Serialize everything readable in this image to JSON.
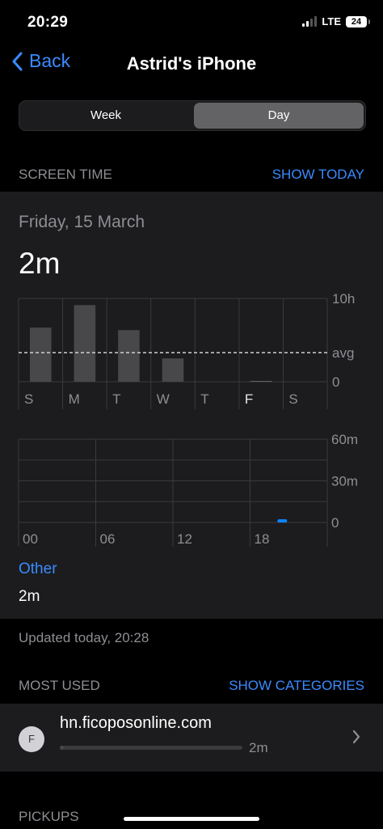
{
  "status_bar": {
    "time": "20:29",
    "network": "LTE",
    "battery": "24"
  },
  "nav": {
    "back_label": "Back",
    "title": "Astrid's iPhone"
  },
  "segments": {
    "week": "Week",
    "day": "Day",
    "selected": "Day"
  },
  "screen_time": {
    "header": "SCREEN TIME",
    "show_today": "SHOW TODAY",
    "date": "Friday, 15 March",
    "total": "2m",
    "weekly_chart": {
      "type": "bar",
      "categories": [
        "S",
        "M",
        "T",
        "W",
        "T",
        "F",
        "S"
      ],
      "values": [
        6.5,
        9.2,
        6.2,
        2.8,
        0,
        0.03,
        0
      ],
      "average": 3.5,
      "tick_labels": [
        "10h",
        "avg",
        "0"
      ],
      "ylim": [
        0,
        10
      ],
      "selected_index": 5
    },
    "hourly_chart": {
      "type": "bar",
      "categories": [
        "00",
        "01",
        "02",
        "03",
        "04",
        "05",
        "06",
        "07",
        "08",
        "09",
        "10",
        "11",
        "12",
        "13",
        "14",
        "15",
        "16",
        "17",
        "18",
        "19",
        "20",
        "21",
        "22",
        "23"
      ],
      "values": [
        0,
        0,
        0,
        0,
        0,
        0,
        0,
        0,
        0,
        0,
        0,
        0,
        0,
        0,
        0,
        0,
        0,
        0,
        0,
        0,
        2,
        0,
        0,
        0
      ],
      "tick_labels": [
        "00",
        "06",
        "12",
        "18"
      ],
      "y_tick_labels": [
        "60m",
        "30m",
        "0"
      ],
      "ylim": [
        0,
        60
      ],
      "bar_color": "#0a84ff"
    },
    "category": {
      "label": "Other",
      "time": "2m"
    }
  },
  "updated": "Updated today, 20:28",
  "most_used": {
    "header": "MOST USED",
    "show_categories": "SHOW CATEGORIES",
    "items": [
      {
        "initial": "F",
        "name": "hn.ficoposonline.com",
        "time": "2m",
        "usage_fraction": 0.02
      }
    ]
  },
  "pickups": {
    "header": "PICKUPS"
  },
  "colors": {
    "accent": "#3a8bff",
    "card": "#1c1c1e",
    "muted": "#8e8e93"
  }
}
